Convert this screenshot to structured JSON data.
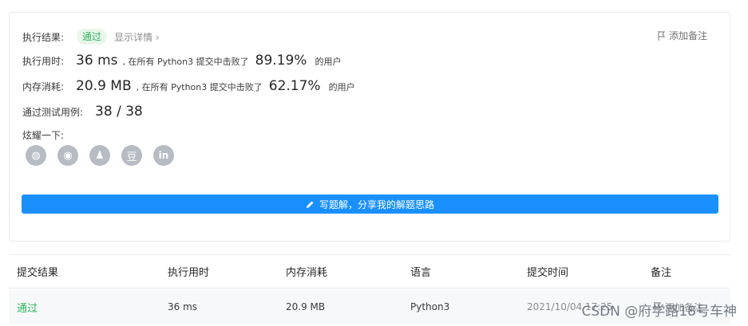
{
  "result": {
    "label": "执行结果:",
    "status": "通过",
    "details_link": "显示详情 ›",
    "add_note": "添加备注"
  },
  "runtime": {
    "label": "执行用时:",
    "value": "36 ms",
    "prefix": ", 在所有 Python3 提交中击败了",
    "percent": "89.19%",
    "suffix": "的用户"
  },
  "memory": {
    "label": "内存消耗:",
    "value": "20.9 MB",
    "prefix": ", 在所有 Python3 提交中击败了",
    "percent": "62.17%",
    "suffix": "的用户"
  },
  "tests": {
    "label": "通过测试用例:",
    "value": "38 / 38"
  },
  "share": {
    "label": "炫耀一下:",
    "icons": [
      {
        "name": "wechat-icon",
        "glyph": "◍"
      },
      {
        "name": "weibo-icon",
        "glyph": "◉"
      },
      {
        "name": "qq-icon",
        "glyph": "♟"
      },
      {
        "name": "douban-icon",
        "glyph": "豆"
      },
      {
        "name": "linkedin-icon",
        "glyph": "in"
      }
    ]
  },
  "write_solution": "写题解，分享我的解题思路",
  "table": {
    "headers": [
      "提交结果",
      "执行用时",
      "内存消耗",
      "语言",
      "提交时间",
      "备注"
    ],
    "row": {
      "result": "通过",
      "runtime": "36 ms",
      "memory": "20.9 MB",
      "language": "Python3",
      "time": "2021/10/04 17:25",
      "note": "添加备注"
    }
  },
  "watermark": "CSDN @府学路18号车神",
  "colors": {
    "accent": "#1a90ff",
    "success": "#2db55d"
  }
}
